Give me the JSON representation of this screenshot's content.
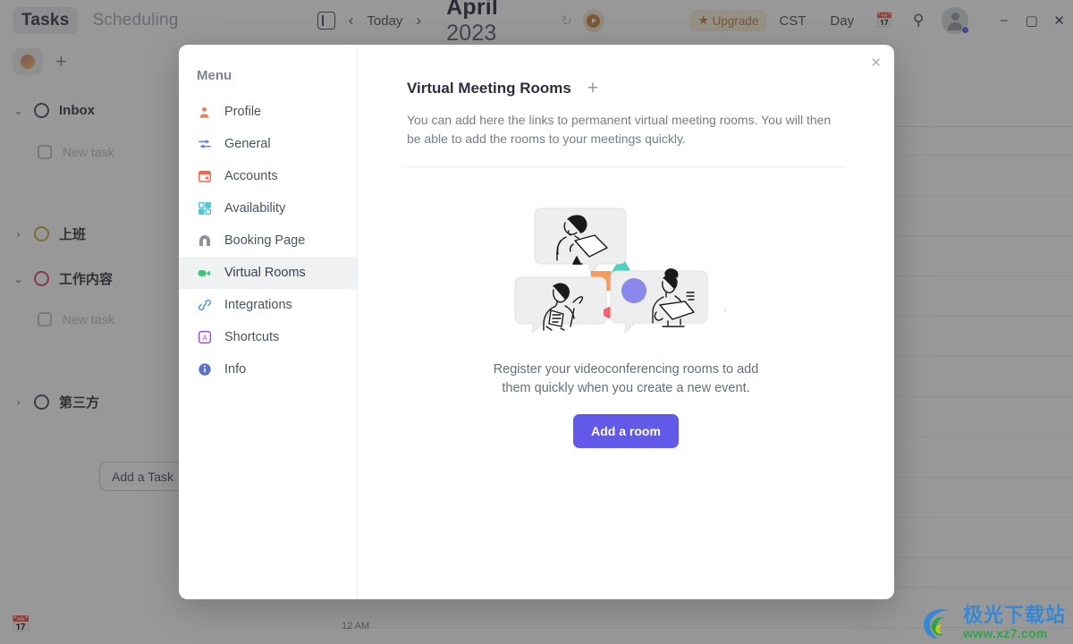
{
  "background": {
    "tabs": [
      {
        "label": "Tasks",
        "active": true
      },
      {
        "label": "Scheduling",
        "active": false
      }
    ],
    "add_project_icon": "plus-icon",
    "groups": [
      {
        "name": "Inbox",
        "expanded": true,
        "ring_color": "#3c4250",
        "chevron": "⌄"
      },
      {
        "name": "上班",
        "expanded": false,
        "ring_color": "#c8a32b",
        "chevron": "›"
      },
      {
        "name": "工作内容",
        "expanded": true,
        "ring_color": "#cf3b6e",
        "chevron": "⌄"
      },
      {
        "name": "第三方",
        "expanded": false,
        "ring_color": "#3c4250",
        "chevron": "›"
      }
    ],
    "placeholder_task": "New task",
    "add_task_label": "Add a Task",
    "toolbar": {
      "sidebar_toggle_icon": "panel-icon",
      "prev_label": "‹",
      "today_label": "Today",
      "next_label": "›",
      "month_name": "April",
      "year": "2023",
      "refresh_icon": "refresh-icon",
      "record_icon": "record-icon",
      "upgrade_label": "Upgrade",
      "upgrade_star": "★",
      "timezone": "CST",
      "view_label": "Day",
      "calendar_icon": "calendar-icon",
      "search_icon": "search-icon",
      "avatar": "user-avatar",
      "minimize": "−",
      "maximize": "▢",
      "close": "✕"
    },
    "hour_label": "12 AM",
    "bottom_calendar_icon": "calendar-icon"
  },
  "modal": {
    "close_icon": "✕",
    "menu": {
      "title": "Menu",
      "items": [
        {
          "label": "Profile",
          "icon": "person-icon",
          "color": "#e08a5c",
          "active": false
        },
        {
          "label": "General",
          "icon": "sliders-icon",
          "color": "#6a7ff0",
          "active": false
        },
        {
          "label": "Accounts",
          "icon": "calendar-icon",
          "color": "#f4694f",
          "active": false
        },
        {
          "label": "Availability",
          "icon": "grid-icon",
          "color": "#53c7d6",
          "active": false
        },
        {
          "label": "Booking Page",
          "icon": "arch-icon",
          "color": "#8d929c",
          "active": false
        },
        {
          "label": "Virtual Rooms",
          "icon": "video-camera-icon",
          "color": "#3fc47e",
          "active": true
        },
        {
          "label": "Integrations",
          "icon": "link-icon",
          "color": "#4d8fd1",
          "active": false
        },
        {
          "label": "Shortcuts",
          "icon": "keyboard-key-icon",
          "color": "#9b4fe0",
          "active": false
        },
        {
          "label": "Info",
          "icon": "info-icon",
          "color": "#5b72c9",
          "active": false
        }
      ]
    },
    "content": {
      "title": "Virtual Meeting Rooms",
      "add_icon": "+",
      "description": "You can add here the links to permanent virtual meeting rooms. You will then be able to add the rooms to your meetings quickly.",
      "illustration": "video-conference-illustration",
      "empty_line1": "Register your videoconferencing rooms to add",
      "empty_line2": "them quickly when you create a new event.",
      "cta_label": "Add a room"
    }
  },
  "watermark": {
    "name": "极光下载站",
    "url": "www.xz7.com"
  },
  "colors": {
    "accent": "#6259e8",
    "active_menu_bg": "#f0f1f3",
    "upgrade": "#b9742d",
    "triangle": "#4ecfc0",
    "square": "#f79a5d",
    "circle": "#8b87ec",
    "hexagon": "#f4616e"
  }
}
